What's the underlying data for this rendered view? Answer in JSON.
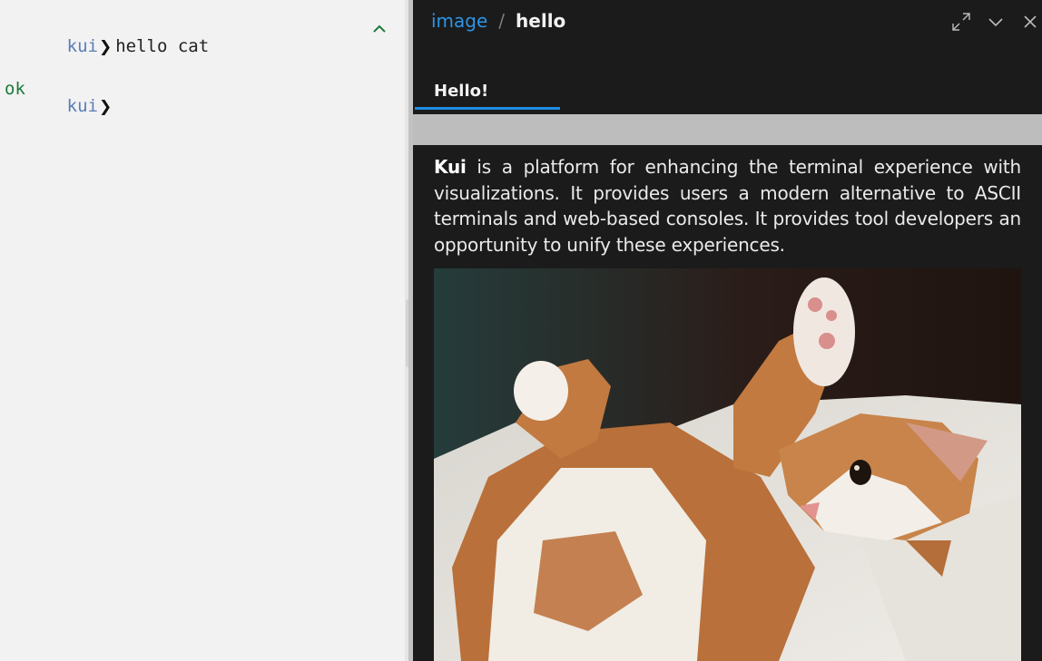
{
  "terminal": {
    "blocks": [
      {
        "prompt": "kui",
        "command": "hello cat",
        "output": "ok"
      },
      {
        "prompt": "kui",
        "command": ""
      }
    ]
  },
  "sidecar": {
    "breadcrumb": {
      "kind": "image",
      "separator": "/",
      "name": "hello"
    },
    "tabs": [
      {
        "label": "Hello!",
        "active": true
      }
    ],
    "description": {
      "bold": "Kui",
      "text": " is a platform for enhancing the terminal experience with visualizations. It provides users a modern alternative to ASCII terminals and web-based consoles. It provides tool developers an opportunity to unify these experiences."
    },
    "image": {
      "subject": "cat"
    }
  },
  "colors": {
    "prompt": "#5a7db8",
    "ok": "#1f7a3a",
    "accent": "#1f8ce5",
    "sidecar_bg": "#1b1b1b"
  }
}
